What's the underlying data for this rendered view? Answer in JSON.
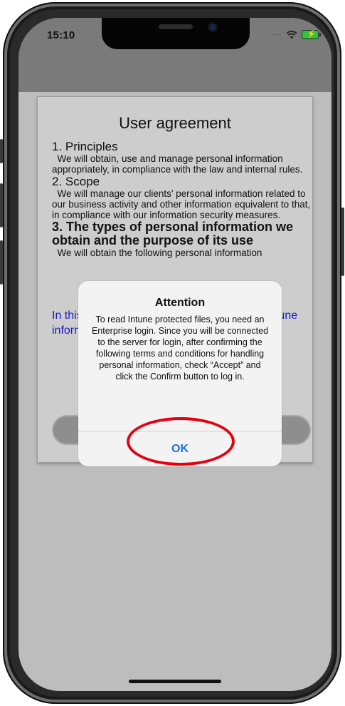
{
  "status_bar": {
    "time": "15:10",
    "signal_dots": "∙∙∙∙",
    "battery_icon": "battery-charging-icon"
  },
  "agreement": {
    "title": "User agreement",
    "sections": [
      {
        "heading": "1. Principles",
        "text": "  We will obtain, use and manage personal information appropriately, in compliance with the law and internal rules."
      },
      {
        "heading": "2. Scope",
        "text": "  We will manage our clients' personal information related to our business activity and other information equivalent to that, in compliance with our information security measures."
      },
      {
        "heading": "3. The types of personal information we obtain and the purpose of its use",
        "text": "  We will obtain the following personal information"
      }
    ],
    "link_text": "In this app, to obtain the following access, Intune information: please"
  },
  "dialog": {
    "title": "Attention",
    "message": "To read Intune protected files, you need an Enterprise login. Since you will be connected to the server for login, after confirming the following terms and conditions for handling personal information, check “Accept” and click the Confirm button to log in.",
    "ok_label": "OK"
  },
  "annotation": {
    "color": "#e6000f"
  }
}
